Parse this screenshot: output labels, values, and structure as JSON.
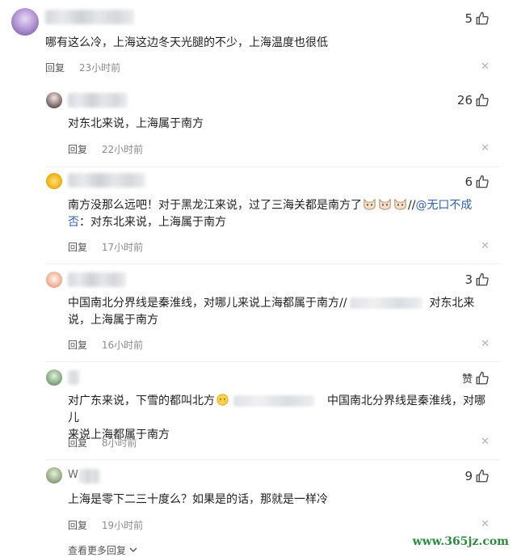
{
  "comments": [
    {
      "likes": "5",
      "text": "哪有这么冷，上海这边冬天光腿的不少，上海温度也很低",
      "reply_label": "回复",
      "time": "23小时前"
    },
    {
      "likes": "26",
      "text": "对东北来说，上海属于南方",
      "reply_label": "回复",
      "time": "22小时前"
    },
    {
      "likes": "6",
      "text_line1": "南方没那么远吧！对于黑龙江来说，过了三海关都是南方了",
      "mention_sep": "//",
      "mention": "@无口不成",
      "text_line2_mention": "否",
      "text_line2": "：对东北来说，上海属于南方",
      "reply_label": "回复",
      "time": "17小时前"
    },
    {
      "likes": "3",
      "text_line1_a": "中国南北分界线是秦淮线，对哪儿来说上海都属于南方//",
      "text_line1_b": "对东北来",
      "text_line2": "说，上海属于南方",
      "reply_label": "回复",
      "time": "16小时前"
    },
    {
      "likes": "赞",
      "text_line1_a": "对广东来说，下雪的都叫北方",
      "text_line1_b": "中国南北分界线是秦淮线，对哪儿",
      "text_line2": "来说上海都属于南方",
      "reply_label": "回复",
      "time": "8小时前"
    },
    {
      "name": "W",
      "likes": "9",
      "text": "上海是零下二三十度么？如果是的话，那就是一样冷",
      "reply_label": "回复",
      "time": "19小时前"
    }
  ],
  "more_replies": "查看更多回复",
  "watermark": "www.365jz.com",
  "close_glyph": "✕"
}
